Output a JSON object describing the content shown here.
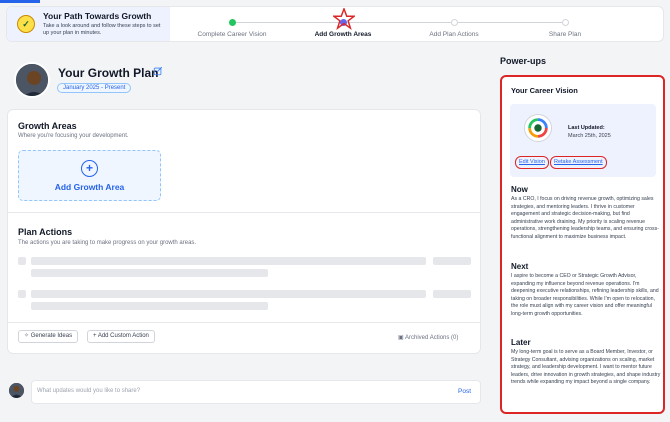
{
  "intro": {
    "title": "Your Path Towards Growth",
    "subtitle": "Take a look around and follow these steps to set up your plan in minutes."
  },
  "steps": [
    {
      "label": "Complete Career Vision",
      "state": "done"
    },
    {
      "label": "Add Growth Areas",
      "state": "current"
    },
    {
      "label": "Add Plan Actions",
      "state": "pending"
    },
    {
      "label": "Share Plan",
      "state": "pending"
    }
  ],
  "header": {
    "title": "Your Growth Plan",
    "date_range": "January 2025 - Present"
  },
  "growth_areas": {
    "title": "Growth Areas",
    "subtitle": "Where you're focusing your development.",
    "add_label": "Add Growth Area"
  },
  "plan_actions": {
    "title": "Plan Actions",
    "subtitle": "The actions you are taking to make progress on your growth areas.",
    "generate_label": "Generate Ideas",
    "custom_label": "+ Add Custom Action",
    "archived_label": "Archived Actions (0)"
  },
  "update": {
    "placeholder": "What updates would you like to share?",
    "post_label": "Post"
  },
  "powerups": {
    "title": "Power-ups",
    "vision": {
      "title": "Your Career Vision",
      "updated_label": "Last Updated:",
      "updated_date": "March 25th, 2025",
      "edit_label": "Edit Vision",
      "retake_label": "Retake Assessment",
      "now_title": "Now",
      "now_text": "As a CRO, I focus on driving revenue growth, optimizing sales strategies, and mentoring leaders. I thrive in customer engagement and strategic decision-making, but find administrative work draining. My priority is scaling revenue operations, strengthening leadership teams, and ensuring cross-functional alignment to maximize business impact.",
      "next_title": "Next",
      "next_text": "I aspire to become a CEO or Strategic Growth Advisor, expanding my influence beyond revenue operations. I'm deepening executive relationships, refining leadership skills, and taking on broader responsibilities. While I'm open to relocation, the role must align with my career vision and offer meaningful long-term growth opportunities.",
      "later_title": "Later",
      "later_text": "My long-term goal is to serve as a Board Member, Investor, or Strategy Consultant, advising organizations on scaling, market strategy, and leadership development. I want to mentor future leaders, drive innovation in growth strategies, and shape industry trends while expanding my impact beyond a single company."
    }
  },
  "colors": {
    "accent": "#2563eb",
    "highlight_border": "#dc2626",
    "done": "#22c55e"
  }
}
